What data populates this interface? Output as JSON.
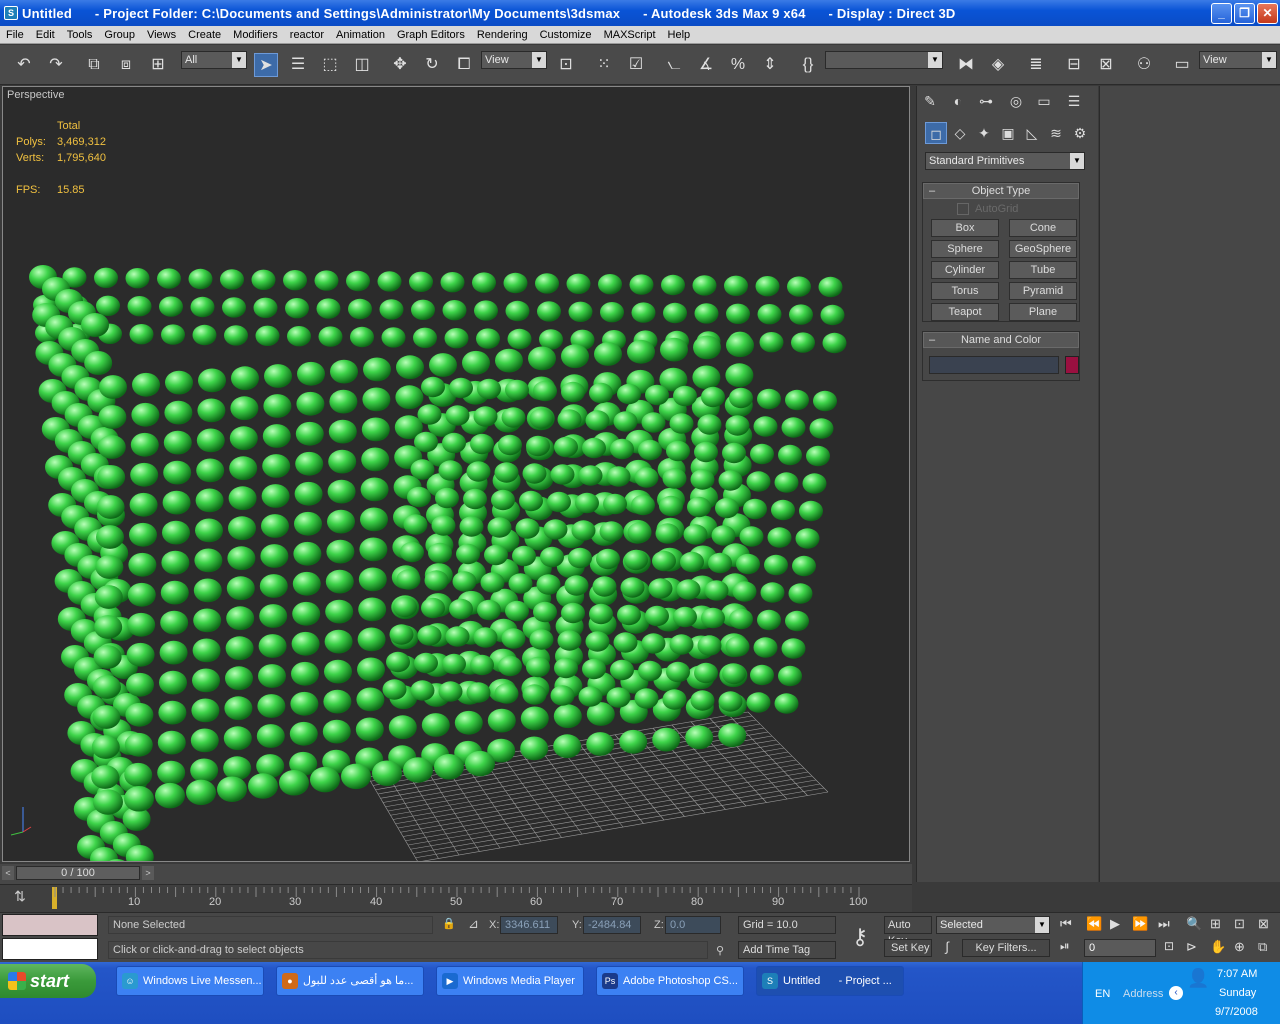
{
  "window": {
    "title": "Untitled      - Project Folder: C:\\Documents and Settings\\Administrator\\My Documents\\3dsmax      - Autodesk 3ds Max 9 x64      - Display : Direct 3D"
  },
  "menu": [
    "File",
    "Edit",
    "Tools",
    "Group",
    "Views",
    "Create",
    "Modifiers",
    "reactor",
    "Animation",
    "Graph Editors",
    "Rendering",
    "Customize",
    "MAXScript",
    "Help"
  ],
  "toolbar": {
    "selection_filter": "All",
    "ref_coord": "View",
    "named_sel": "",
    "render_view": "View"
  },
  "viewport": {
    "label": "Perspective",
    "stats": {
      "header": "Total",
      "polys_label": "Polys:",
      "polys": "3,469,312",
      "verts_label": "Verts:",
      "verts": "1,795,640",
      "fps_label": "FPS:",
      "fps": "15.85"
    },
    "colors": {
      "object": "#2ecc40",
      "background": "#2b2b2b",
      "grid": "#9a9a9a"
    }
  },
  "command_panel": {
    "category": "Standard Primitives",
    "object_type": {
      "title": "Object Type",
      "autogrid": "AutoGrid",
      "buttons": [
        "Box",
        "Cone",
        "Sphere",
        "GeoSphere",
        "Cylinder",
        "Tube",
        "Torus",
        "Pyramid",
        "Teapot",
        "Plane"
      ]
    },
    "name_color": {
      "title": "Name and Color",
      "name_value": "",
      "color": "#9a1040"
    }
  },
  "timeline": {
    "frame_display": "0 / 100",
    "ticks": [
      "10",
      "20",
      "30",
      "40",
      "50",
      "60",
      "70",
      "80",
      "90",
      "100"
    ]
  },
  "status": {
    "selection": "None Selected",
    "prompt": "Click or click-and-drag to select objects",
    "x_label": "X:",
    "x": "3346.611",
    "y_label": "Y:",
    "y": "-2484.84",
    "z_label": "Z:",
    "z": "0.0",
    "grid": "Grid = 10.0",
    "add_time_tag": "Add Time Tag",
    "auto_key": "Auto Key",
    "set_key": "Set Key",
    "key_mode": "Selected",
    "key_filters": "Key Filters...",
    "current_frame": "0"
  },
  "taskbar": {
    "start": "start",
    "tasks": [
      {
        "label": "Windows Live Messen...",
        "icon": "messenger-icon",
        "color": "#2a9ad0"
      },
      {
        "label": "ما هو أقصى عدد للبول...",
        "icon": "firefox-icon",
        "color": "#d06a1a"
      },
      {
        "label": "Windows Media Player",
        "icon": "media-player-icon",
        "color": "#1a6ad0"
      },
      {
        "label": "Adobe Photoshop CS...",
        "icon": "photoshop-icon",
        "color": "#1a3a8a"
      },
      {
        "label": "Untitled      - Project ...",
        "icon": "3dsmax-icon",
        "color": "#1d7fb8"
      }
    ],
    "lang": "EN",
    "address": "Address",
    "time": "7:07 AM",
    "day": "Sunday",
    "date": "9/7/2008"
  }
}
